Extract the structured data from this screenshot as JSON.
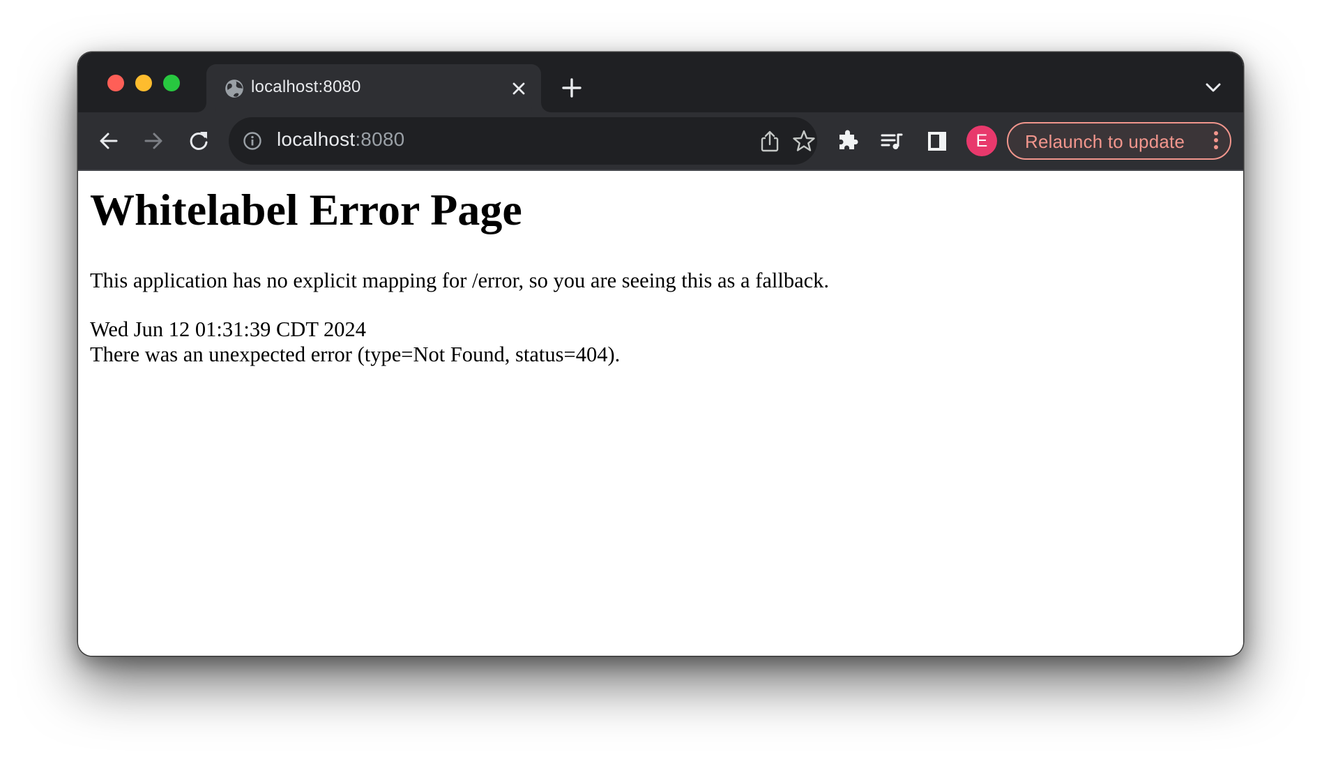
{
  "browser": {
    "tab": {
      "title": "localhost:8080",
      "favicon": "globe-icon"
    },
    "new_tab_icon": "plus-icon",
    "tab_search_icon": "chevron-down-icon",
    "toolbar": {
      "back_icon": "arrow-left-icon",
      "forward_icon": "arrow-right-icon",
      "reload_icon": "reload-icon",
      "address": {
        "host": "localhost",
        "port": ":8080",
        "security_icon": "info-icon"
      },
      "share_icon": "share-icon",
      "bookmark_icon": "star-icon",
      "extensions_icon": "puzzle-icon",
      "media_icon": "media-queue-icon",
      "side_panel_icon": "side-panel-icon",
      "profile": {
        "initial": "E",
        "color": "#e8396c"
      },
      "relaunch_label": "Relaunch to update",
      "relaunch_color": "#f2968d"
    }
  },
  "page": {
    "heading": "Whitelabel Error Page",
    "message": "This application has no explicit mapping for /error, so you are seeing this as a fallback.",
    "timestamp": "Wed Jun 12 01:31:39 CDT 2024",
    "error": "There was an unexpected error (type=Not Found, status=404)."
  }
}
